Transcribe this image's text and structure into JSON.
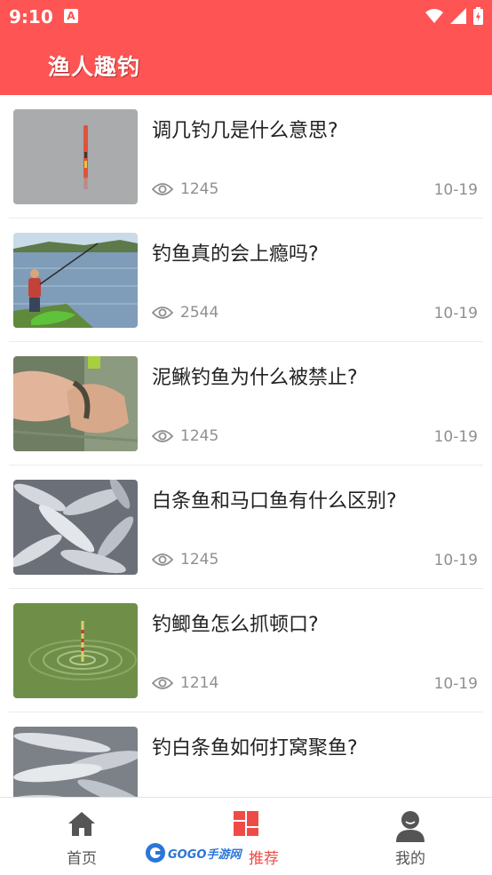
{
  "status_bar": {
    "time": "9:10",
    "notification_glyph": "A"
  },
  "header": {
    "title": "渔人趣钓",
    "background": "#fe5453"
  },
  "articles": [
    {
      "title": "调几钓几是什么意思?",
      "views": "1245",
      "date": "10-19",
      "thumb": "float-grey-water-thumbnail"
    },
    {
      "title": "钓鱼真的会上瘾吗?",
      "views": "2544",
      "date": "10-19",
      "thumb": "angler-at-lake-thumbnail"
    },
    {
      "title": "泥鳅钓鱼为什么被禁止?",
      "views": "1245",
      "date": "10-19",
      "thumb": "hand-holding-loach-thumbnail"
    },
    {
      "title": "白条鱼和马口鱼有什么区别?",
      "views": "1245",
      "date": "10-19",
      "thumb": "pile-of-small-fish-thumbnail"
    },
    {
      "title": "钓鲫鱼怎么抓顿口?",
      "views": "1214",
      "date": "10-19",
      "thumb": "float-green-water-thumbnail"
    },
    {
      "title": "钓白条鱼如何打窝聚鱼?",
      "views": "",
      "date": "",
      "thumb": "white-fish-pile-thumbnail"
    }
  ],
  "bottom_nav": [
    {
      "label": "首页",
      "icon": "home-icon",
      "active": false
    },
    {
      "label": "推荐",
      "icon": "grid-icon",
      "active": true
    },
    {
      "label": "我的",
      "icon": "user-icon",
      "active": false
    }
  ],
  "watermark": {
    "text": "GOGO手游网"
  },
  "colors": {
    "accent": "#fe5453",
    "active_tab": "#f04a47",
    "meta_text": "#8f8f8f"
  }
}
